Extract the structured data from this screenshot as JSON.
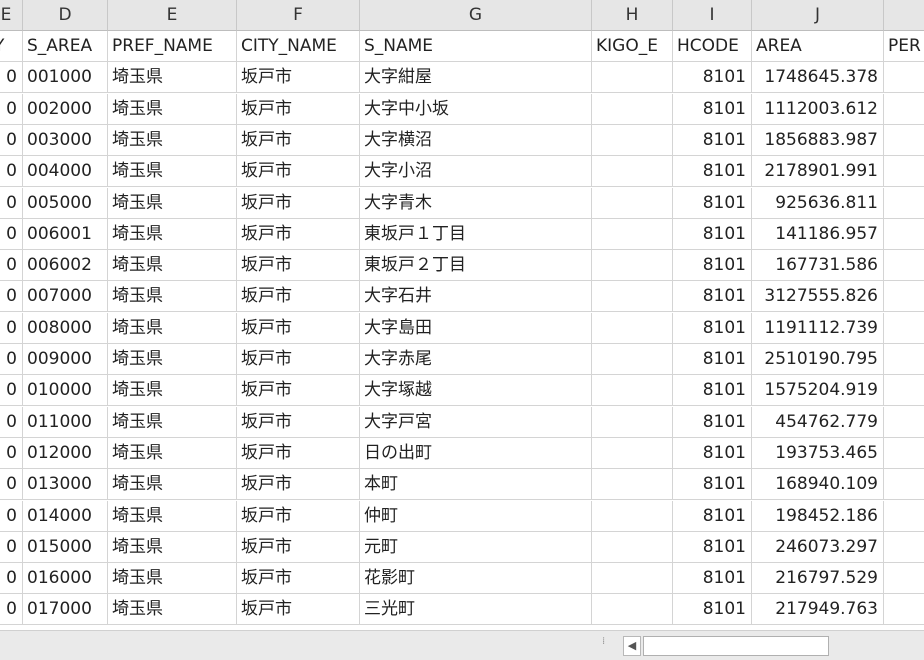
{
  "columns": [
    "E",
    "D",
    "E",
    "F",
    "G",
    "H",
    "I",
    "J",
    ""
  ],
  "header_row": [
    "Y",
    "S_AREA",
    "PREF_NAME",
    "CITY_NAME",
    "S_NAME",
    "KIGO_E",
    "HCODE",
    "AREA",
    "PER"
  ],
  "rows": [
    [
      "0",
      "001000",
      "埼玉県",
      "坂戸市",
      "大字紺屋",
      "",
      "8101",
      "1748645.378",
      ""
    ],
    [
      "0",
      "002000",
      "埼玉県",
      "坂戸市",
      "大字中小坂",
      "",
      "8101",
      "1112003.612",
      ""
    ],
    [
      "0",
      "003000",
      "埼玉県",
      "坂戸市",
      "大字横沼",
      "",
      "8101",
      "1856883.987",
      ""
    ],
    [
      "0",
      "004000",
      "埼玉県",
      "坂戸市",
      "大字小沼",
      "",
      "8101",
      "2178901.991",
      ""
    ],
    [
      "0",
      "005000",
      "埼玉県",
      "坂戸市",
      "大字青木",
      "",
      "8101",
      "925636.811",
      ""
    ],
    [
      "0",
      "006001",
      "埼玉県",
      "坂戸市",
      "東坂戸１丁目",
      "",
      "8101",
      "141186.957",
      ""
    ],
    [
      "0",
      "006002",
      "埼玉県",
      "坂戸市",
      "東坂戸２丁目",
      "",
      "8101",
      "167731.586",
      ""
    ],
    [
      "0",
      "007000",
      "埼玉県",
      "坂戸市",
      "大字石井",
      "",
      "8101",
      "3127555.826",
      ""
    ],
    [
      "0",
      "008000",
      "埼玉県",
      "坂戸市",
      "大字島田",
      "",
      "8101",
      "1191112.739",
      ""
    ],
    [
      "0",
      "009000",
      "埼玉県",
      "坂戸市",
      "大字赤尾",
      "",
      "8101",
      "2510190.795",
      ""
    ],
    [
      "0",
      "010000",
      "埼玉県",
      "坂戸市",
      "大字塚越",
      "",
      "8101",
      "1575204.919",
      ""
    ],
    [
      "0",
      "011000",
      "埼玉県",
      "坂戸市",
      "大字戸宮",
      "",
      "8101",
      "454762.779",
      ""
    ],
    [
      "0",
      "012000",
      "埼玉県",
      "坂戸市",
      "日の出町",
      "",
      "8101",
      "193753.465",
      ""
    ],
    [
      "0",
      "013000",
      "埼玉県",
      "坂戸市",
      "本町",
      "",
      "8101",
      "168940.109",
      ""
    ],
    [
      "0",
      "014000",
      "埼玉県",
      "坂戸市",
      "仲町",
      "",
      "8101",
      "198452.186",
      ""
    ],
    [
      "0",
      "015000",
      "埼玉県",
      "坂戸市",
      "元町",
      "",
      "8101",
      "246073.297",
      ""
    ],
    [
      "0",
      "016000",
      "埼玉県",
      "坂戸市",
      "花影町",
      "",
      "8101",
      "216797.529",
      ""
    ],
    [
      "0",
      "017000",
      "埼玉県",
      "坂戸市",
      "三光町",
      "",
      "8101",
      "217949.763",
      ""
    ]
  ],
  "scrollbar": {
    "left_arrow": "◀"
  },
  "colors": {
    "header_bg": "#e6e6e6",
    "grid": "#d4d4d4",
    "background": "#ffffff"
  }
}
